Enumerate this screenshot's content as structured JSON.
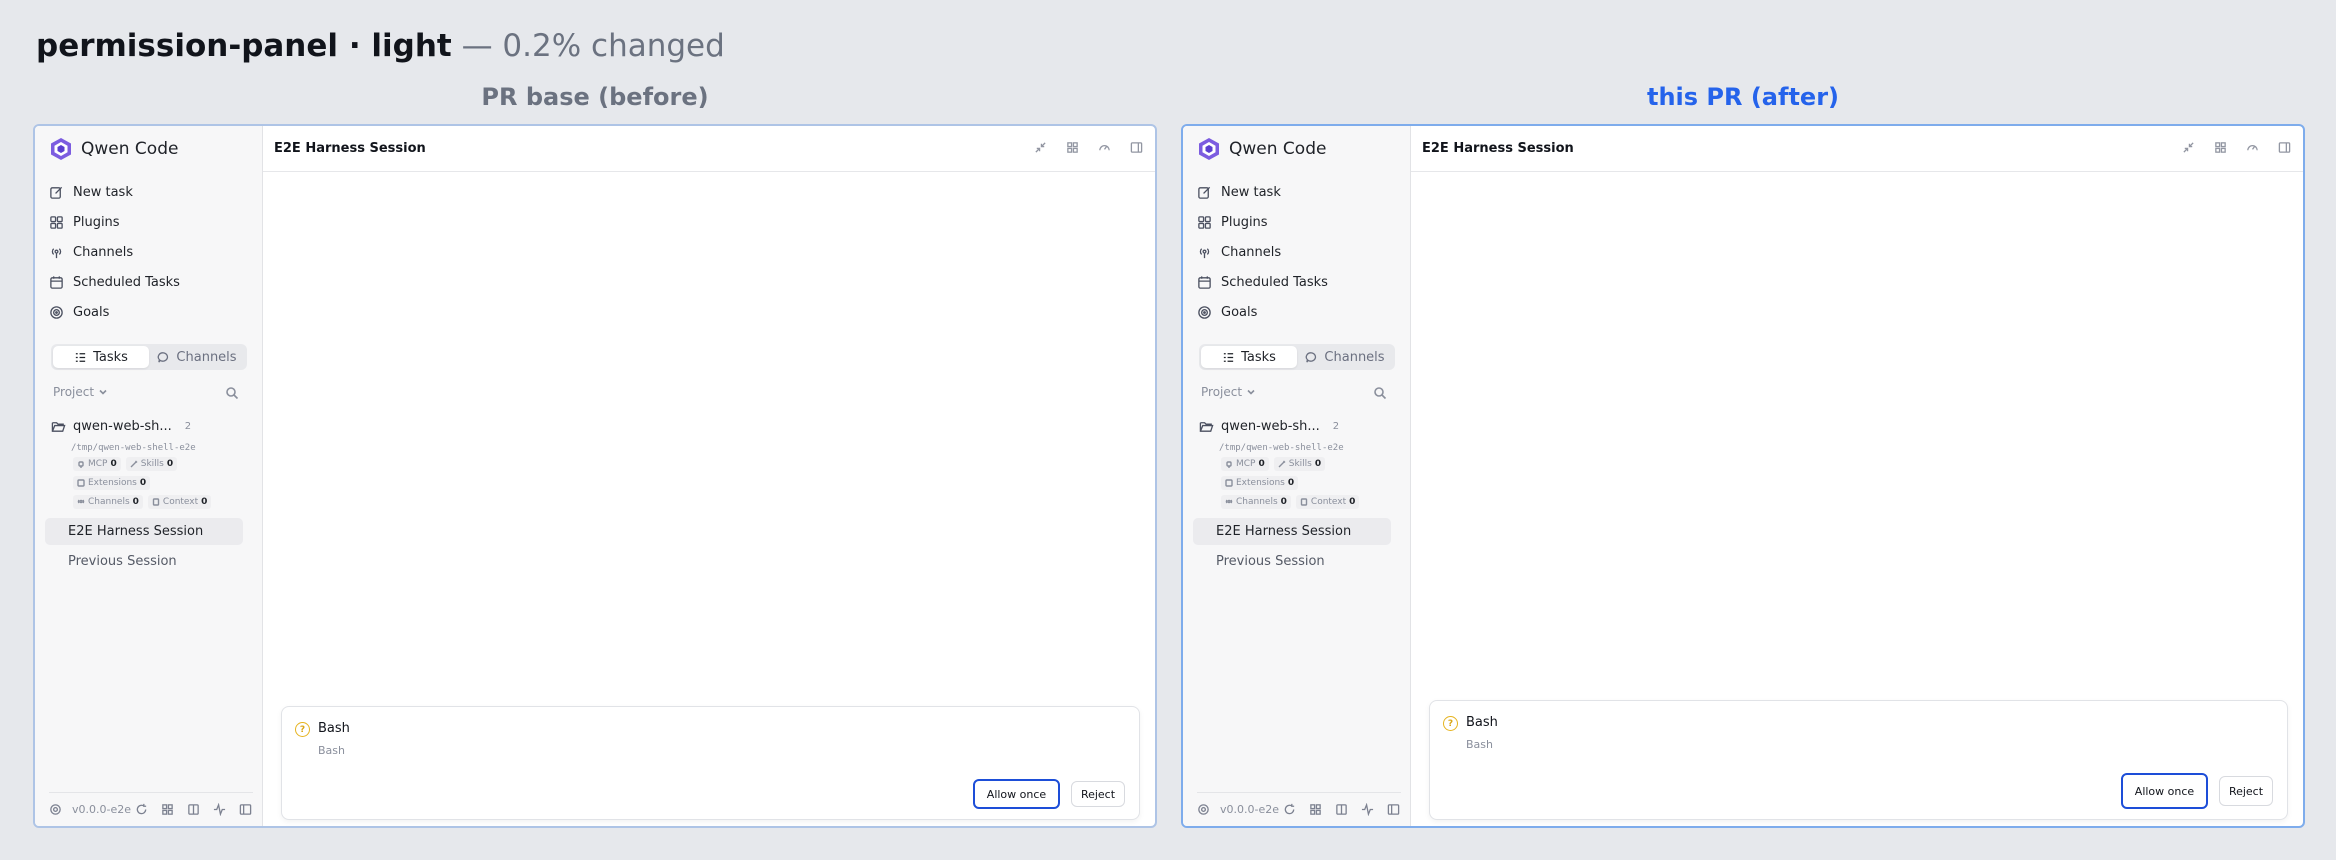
{
  "heading": {
    "title": "permission-panel · light",
    "subtitle": "— 0.2% changed"
  },
  "panels": [
    {
      "label": "PR base (before)",
      "app_name": "Qwen Code",
      "nav": [
        "New task",
        "Plugins",
        "Channels",
        "Scheduled Tasks",
        "Goals"
      ],
      "tabs": [
        "Tasks",
        "Channels"
      ],
      "project_label": "Project",
      "workspace": {
        "name": "qwen-web-sh...",
        "count": "2",
        "path": "/tmp/qwen-web-shell-e2e"
      },
      "chips": {
        "mcp": "MCP",
        "mcp_count": "0",
        "skills": "Skills",
        "skills_count": "0",
        "extensions": "Extensions",
        "extensions_count": "0",
        "channels": "Channels",
        "channels_count": "0",
        "context": "Context",
        "context_count": "0"
      },
      "sessions": [
        "E2E Harness Session",
        "Previous Session"
      ],
      "version": "v0.0.0-e2e",
      "session_title": "E2E Harness Session",
      "permission": {
        "tool": "Bash",
        "detail": "Bash",
        "allow": "Allow once",
        "reject": "Reject"
      }
    },
    {
      "label": "this PR (after)",
      "app_name": "Qwen Code",
      "nav": [
        "New task",
        "Plugins",
        "Channels",
        "Scheduled Tasks",
        "Goals"
      ],
      "tabs": [
        "Tasks",
        "Channels"
      ],
      "project_label": "Project",
      "workspace": {
        "name": "qwen-web-sh...",
        "count": "2",
        "path": "/tmp/qwen-web-shell-e2e"
      },
      "chips": {
        "mcp": "MCP",
        "mcp_count": "0",
        "skills": "Skills",
        "skills_count": "0",
        "extensions": "Extensions",
        "extensions_count": "0",
        "channels": "Channels",
        "channels_count": "0",
        "context": "Context",
        "context_count": "0"
      },
      "sessions": [
        "E2E Harness Session",
        "Previous Session"
      ],
      "version": "v0.0.0-e2e",
      "session_title": "E2E Harness Session",
      "permission": {
        "tool": "Bash",
        "detail": "Bash",
        "allow": "Allow once",
        "reject": "Reject"
      }
    }
  ],
  "colors": {
    "before_label": "#6b7280",
    "after_label": "#2563eb",
    "allow_border": "#1d4ed8",
    "warning": "#e6b420"
  }
}
